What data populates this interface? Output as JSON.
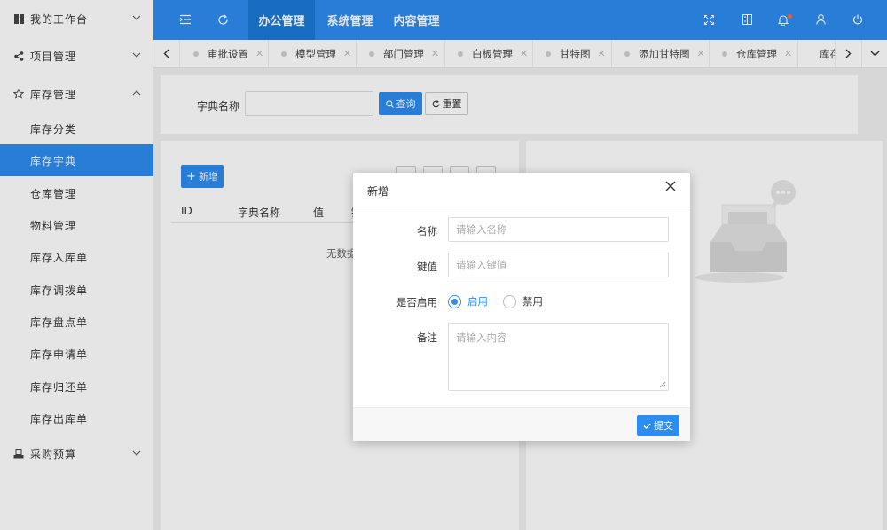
{
  "sidebar": {
    "groups": [
      {
        "label": "我的工作台",
        "icon": "windows-icon"
      },
      {
        "label": "项目管理",
        "icon": "share-icon"
      },
      {
        "label": "库存管理",
        "icon": "star-icon"
      },
      {
        "label": "采购预算",
        "icon": "inbox-icon"
      }
    ],
    "subitems": [
      "库存分类",
      "库存字典",
      "仓库管理",
      "物料管理",
      "库存入库单",
      "库存调拨单",
      "库存盘点单",
      "库存申请单",
      "库存归还单",
      "库存出库单"
    ],
    "active_subitem": "库存字典"
  },
  "topbar": {
    "menus": [
      "办公管理",
      "系统管理",
      "内容管理"
    ],
    "active_menu": "办公管理"
  },
  "tabs": [
    "审批设置",
    "模型管理",
    "部门管理",
    "白板管理",
    "甘特图",
    "添加甘特图",
    "仓库管理",
    "库存"
  ],
  "search": {
    "label": "字典名称",
    "query_label": "查询",
    "reset_label": "重置"
  },
  "table": {
    "add_label": "新增",
    "columns": [
      "ID",
      "字典名称",
      "值",
      "键"
    ],
    "empty_text": "无数据"
  },
  "modal": {
    "title": "新增",
    "fields": {
      "name_label": "名称",
      "name_placeholder": "请输入名称",
      "key_label": "键值",
      "key_placeholder": "请输入键值",
      "enabled_label": "是否启用",
      "enabled_on": "启用",
      "enabled_off": "禁用",
      "enabled_value": "启用",
      "remark_label": "备注",
      "remark_placeholder": "请输入内容"
    },
    "submit_label": "提交"
  },
  "colors": {
    "primary": "#2d8cf0",
    "badge": "#ff6b3d"
  }
}
